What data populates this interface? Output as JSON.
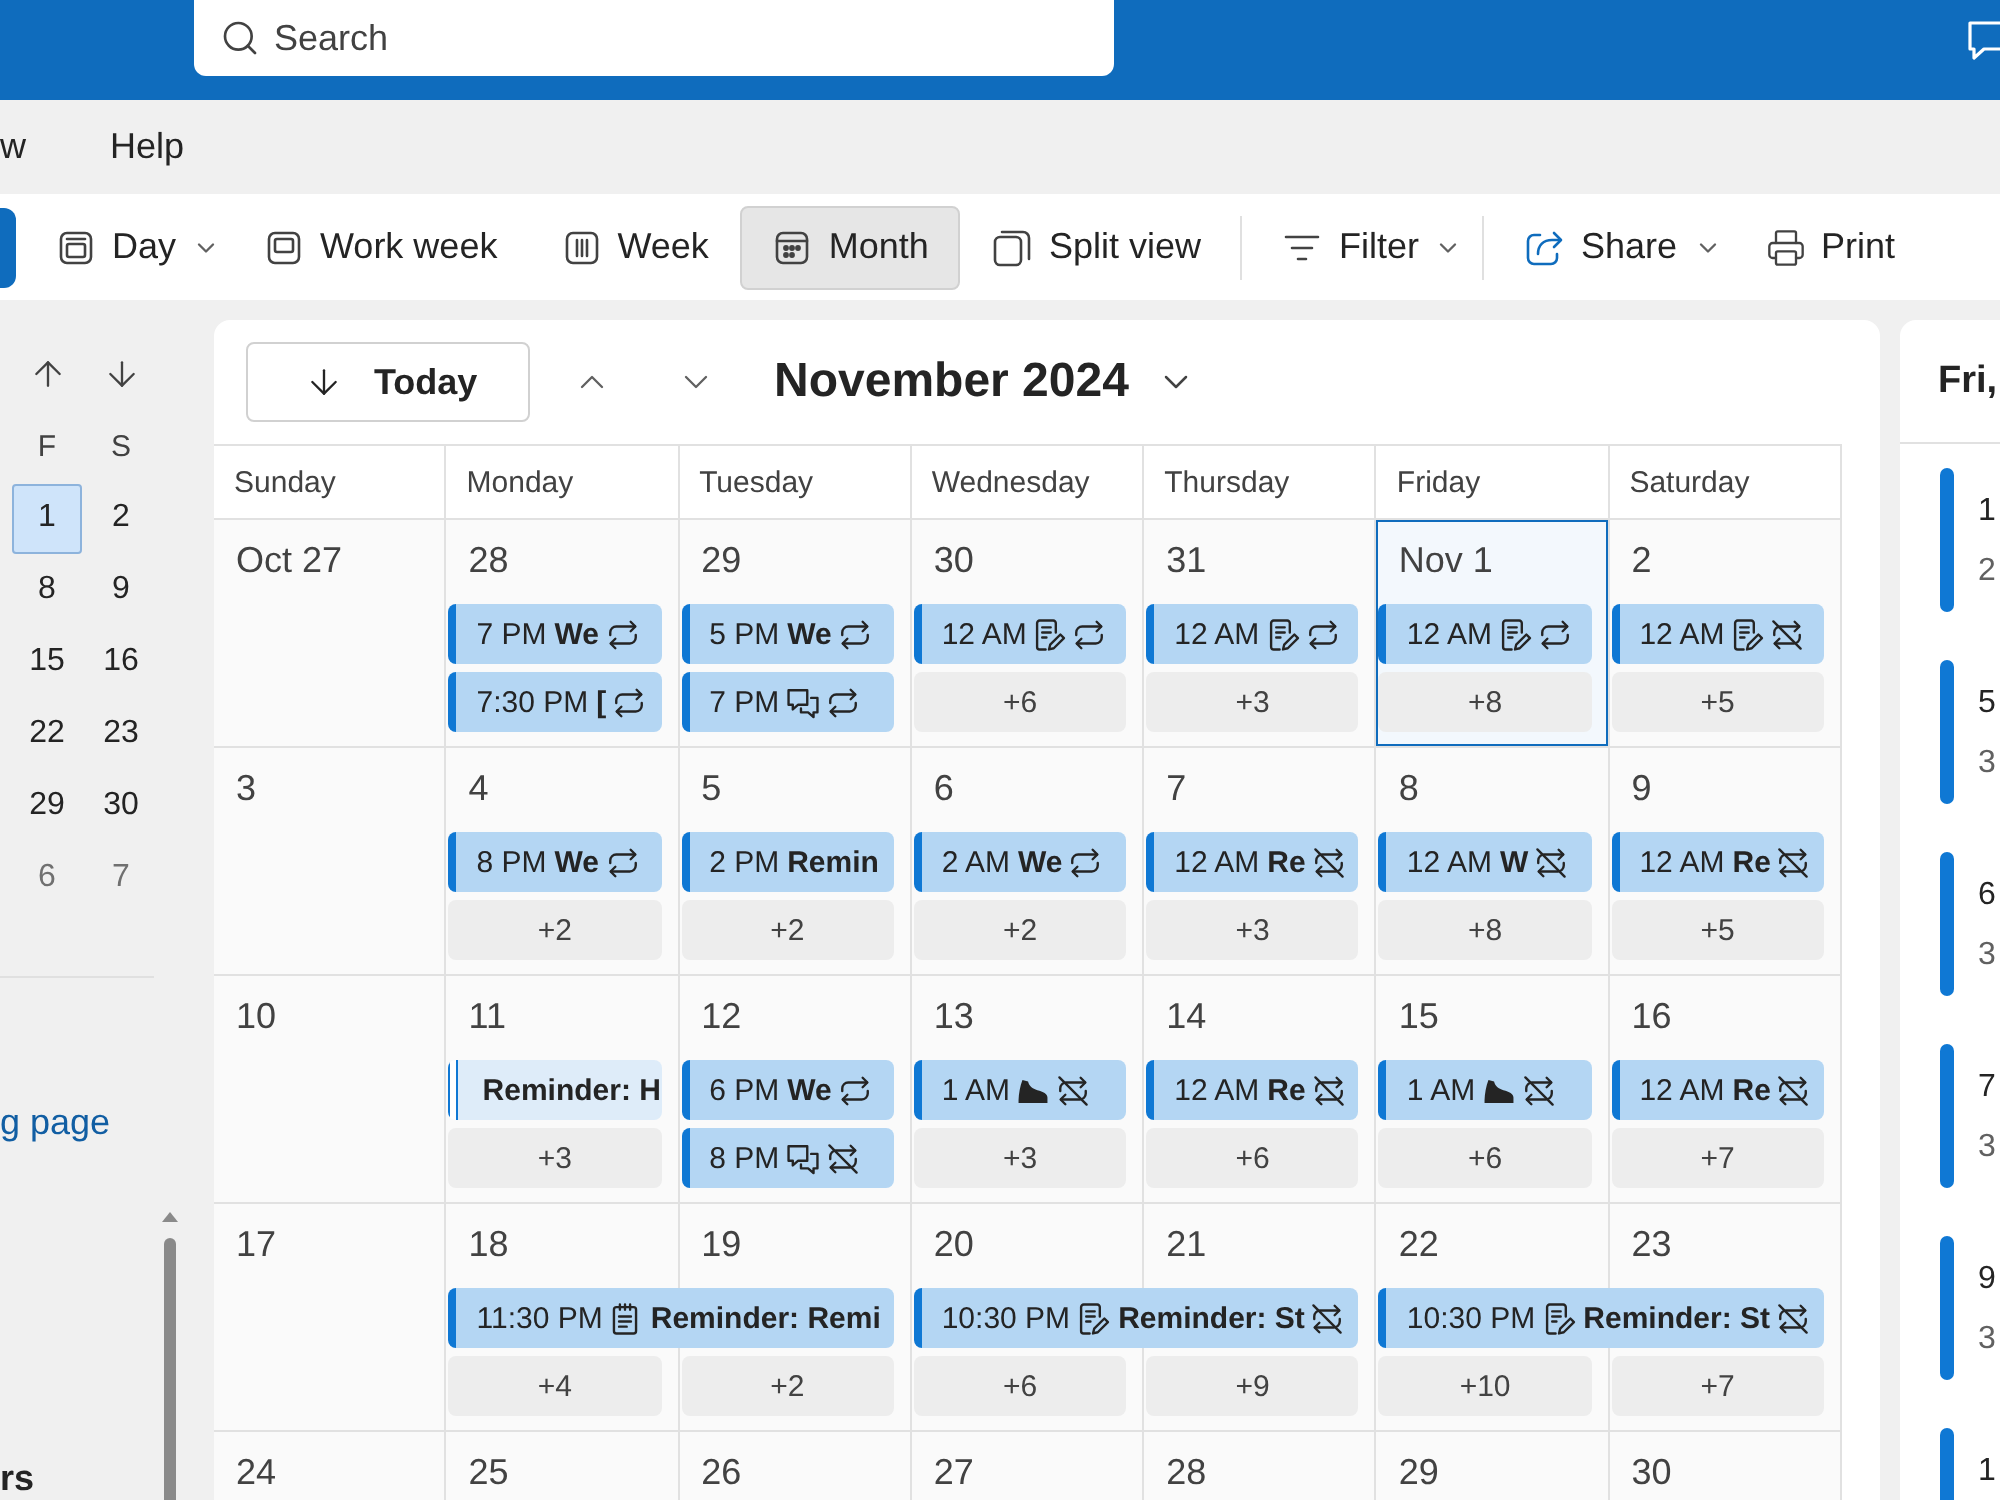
{
  "top_bar": {
    "search": {
      "placeholder": "Search"
    }
  },
  "menu": [
    {
      "label": "w"
    },
    {
      "label": "Help"
    }
  ],
  "toolbar": {
    "views": [
      {
        "label": "Day",
        "dropdown": true,
        "selected": false
      },
      {
        "label": "Work week",
        "dropdown": false,
        "selected": false
      },
      {
        "label": "Week",
        "dropdown": false,
        "selected": false
      },
      {
        "label": "Month",
        "dropdown": false,
        "selected": true
      },
      {
        "label": "Split view",
        "dropdown": false,
        "selected": false
      }
    ],
    "action_groups": [
      [
        {
          "label": "Filter",
          "dropdown": true
        }
      ],
      [
        {
          "label": "Share",
          "dropdown": true
        },
        {
          "label": "Print",
          "dropdown": false
        }
      ]
    ]
  },
  "mini_calendar": {
    "weekday_headers": [
      "F",
      "S"
    ],
    "weeks": [
      [
        {
          "label": "1",
          "selected": true,
          "outside_month": false
        },
        {
          "label": "2",
          "selected": false,
          "outside_month": false
        }
      ],
      [
        {
          "label": "8",
          "selected": false,
          "outside_month": false
        },
        {
          "label": "9",
          "selected": false,
          "outside_month": false
        }
      ],
      [
        {
          "label": "15",
          "selected": false,
          "outside_month": false
        },
        {
          "label": "16",
          "selected": false,
          "outside_month": false
        }
      ],
      [
        {
          "label": "22",
          "selected": false,
          "outside_month": false
        },
        {
          "label": "23",
          "selected": false,
          "outside_month": false
        }
      ],
      [
        {
          "label": "29",
          "selected": false,
          "outside_month": false
        },
        {
          "label": "30",
          "selected": false,
          "outside_month": false
        }
      ],
      [
        {
          "label": "6",
          "selected": false,
          "outside_month": true
        },
        {
          "label": "7",
          "selected": false,
          "outside_month": true
        }
      ]
    ]
  },
  "sidebar": {
    "link": "g page",
    "section_title": "rs"
  },
  "calendar": {
    "today_button": "Today",
    "title": "November 2024",
    "weekdays": [
      "Sunday",
      "Monday",
      "Tuesday",
      "Wednesday",
      "Thursday",
      "Friday",
      "Saturday"
    ],
    "weeks": [
      {
        "days": [
          {
            "date": "Oct 27",
            "selected": false
          },
          {
            "date": "28",
            "selected": false,
            "events": [
              {
                "time": "7 PM",
                "title": "We",
                "kind": "plain",
                "recurring": true,
                "exception": false,
                "free": false,
                "multi_day": false
              },
              {
                "time": "7:30 PM",
                "title": "[",
                "kind": "plain",
                "recurring": true,
                "exception": false,
                "free": false,
                "multi_day": false
              }
            ]
          },
          {
            "date": "29",
            "selected": false,
            "events": [
              {
                "time": "5 PM",
                "title": "We",
                "kind": "plain",
                "recurring": true,
                "exception": false,
                "free": false,
                "multi_day": false
              },
              {
                "time": "7 PM",
                "kind": "chat",
                "recurring": true,
                "exception": false,
                "free": false,
                "multi_day": false
              }
            ]
          },
          {
            "date": "30",
            "selected": false,
            "events": [
              {
                "time": "12 AM",
                "kind": "note",
                "recurring": true,
                "exception": false,
                "free": false,
                "multi_day": false
              }
            ],
            "more": "+6"
          },
          {
            "date": "31",
            "selected": false,
            "events": [
              {
                "time": "12 AM",
                "kind": "note",
                "recurring": true,
                "exception": false,
                "free": false,
                "multi_day": false
              }
            ],
            "more": "+3"
          },
          {
            "date": "Nov 1",
            "selected": true,
            "events": [
              {
                "time": "12 AM",
                "kind": "note",
                "recurring": true,
                "exception": false,
                "free": false,
                "multi_day": false
              }
            ],
            "more": "+8"
          },
          {
            "date": "2",
            "selected": false,
            "events": [
              {
                "time": "12 AM",
                "kind": "note",
                "recurring": true,
                "exception": true,
                "free": false,
                "multi_day": false
              }
            ],
            "more": "+5"
          }
        ]
      },
      {
        "days": [
          {
            "date": "3",
            "selected": false
          },
          {
            "date": "4",
            "selected": false,
            "events": [
              {
                "time": "8 PM",
                "title": "We",
                "kind": "plain",
                "recurring": true,
                "exception": false,
                "free": false,
                "multi_day": false
              }
            ],
            "more": "+2"
          },
          {
            "date": "5",
            "selected": false,
            "events": [
              {
                "time": "2 PM",
                "title": "Remin",
                "kind": "plain",
                "recurring": false,
                "free": false,
                "multi_day": false
              }
            ],
            "more": "+2"
          },
          {
            "date": "6",
            "selected": false,
            "events": [
              {
                "time": "2 AM",
                "title": "We",
                "kind": "plain",
                "recurring": true,
                "exception": false,
                "free": false,
                "multi_day": false
              }
            ],
            "more": "+2"
          },
          {
            "date": "7",
            "selected": false,
            "events": [
              {
                "time": "12 AM",
                "title": "Re",
                "kind": "plain",
                "recurring": true,
                "exception": true,
                "free": false,
                "multi_day": false
              }
            ],
            "more": "+3"
          },
          {
            "date": "8",
            "selected": false,
            "events": [
              {
                "time": "12 AM",
                "title": "W",
                "kind": "plain",
                "recurring": true,
                "exception": true,
                "free": false,
                "multi_day": false
              }
            ],
            "more": "+8"
          },
          {
            "date": "9",
            "selected": false,
            "events": [
              {
                "time": "12 AM",
                "title": "Re",
                "kind": "plain",
                "recurring": true,
                "exception": true,
                "free": false,
                "multi_day": false
              }
            ],
            "more": "+5"
          }
        ]
      },
      {
        "days": [
          {
            "date": "10",
            "selected": false
          },
          {
            "date": "11",
            "selected": false,
            "events": [
              {
                "title": "Reminder: H",
                "kind": "plain",
                "recurring": false,
                "free": true,
                "multi_day": false
              }
            ],
            "more": "+3"
          },
          {
            "date": "12",
            "selected": false,
            "events": [
              {
                "time": "6 PM",
                "title": "We",
                "kind": "plain",
                "recurring": true,
                "exception": false,
                "free": false,
                "multi_day": false
              },
              {
                "time": "8 PM",
                "kind": "chat",
                "recurring": true,
                "exception": true,
                "free": false,
                "multi_day": false
              }
            ]
          },
          {
            "date": "13",
            "selected": false,
            "events": [
              {
                "time": "1 AM",
                "kind": "workout",
                "recurring": true,
                "exception": true,
                "free": false,
                "multi_day": false
              }
            ],
            "more": "+3"
          },
          {
            "date": "14",
            "selected": false,
            "events": [
              {
                "time": "12 AM",
                "title": "Re",
                "kind": "plain",
                "recurring": true,
                "exception": true,
                "free": false,
                "multi_day": false
              }
            ],
            "more": "+6"
          },
          {
            "date": "15",
            "selected": false,
            "events": [
              {
                "time": "1 AM",
                "kind": "workout",
                "recurring": true,
                "exception": true,
                "free": false,
                "multi_day": false
              }
            ],
            "more": "+6"
          },
          {
            "date": "16",
            "selected": false,
            "events": [
              {
                "time": "12 AM",
                "title": "Re",
                "kind": "plain",
                "recurring": true,
                "exception": true,
                "free": false,
                "multi_day": false
              }
            ],
            "more": "+7"
          }
        ]
      },
      {
        "days": [
          {
            "date": "17",
            "selected": false
          },
          {
            "date": "18",
            "selected": false,
            "events": [
              {
                "time": "11:30 PM",
                "title": "Reminder: Remi",
                "kind": "task",
                "recurring": false,
                "free": false,
                "multi_day": true
              }
            ],
            "more": "+4"
          },
          {
            "date": "19",
            "selected": false,
            "more": "+2"
          },
          {
            "date": "20",
            "selected": false,
            "events": [
              {
                "time": "10:30 PM",
                "title": "Reminder: St",
                "kind": "note",
                "recurring": true,
                "exception": true,
                "free": false,
                "multi_day": true
              }
            ],
            "more": "+6"
          },
          {
            "date": "21",
            "selected": false,
            "more": "+9"
          },
          {
            "date": "22",
            "selected": false,
            "events": [
              {
                "time": "10:30 PM",
                "title": "Reminder: St",
                "kind": "note",
                "recurring": true,
                "exception": true,
                "free": false,
                "multi_day": true
              }
            ],
            "more": "+10"
          },
          {
            "date": "23",
            "selected": false,
            "more": "+7"
          }
        ]
      },
      {
        "days": [
          {
            "date": "24",
            "selected": false
          },
          {
            "date": "25",
            "selected": false
          },
          {
            "date": "26",
            "selected": false
          },
          {
            "date": "27",
            "selected": false
          },
          {
            "date": "28",
            "selected": false
          },
          {
            "date": "29",
            "selected": false
          },
          {
            "date": "30",
            "selected": false
          }
        ]
      }
    ]
  },
  "agenda": {
    "title": "Fri,",
    "items": [
      {
        "first_line": "1",
        "second_line": "2"
      },
      {
        "first_line": "5",
        "second_line": "3"
      },
      {
        "first_line": "6",
        "second_line": "3"
      },
      {
        "first_line": "7",
        "second_line": "3"
      },
      {
        "first_line": "9",
        "second_line": "3"
      },
      {
        "first_line": "1"
      }
    ]
  }
}
